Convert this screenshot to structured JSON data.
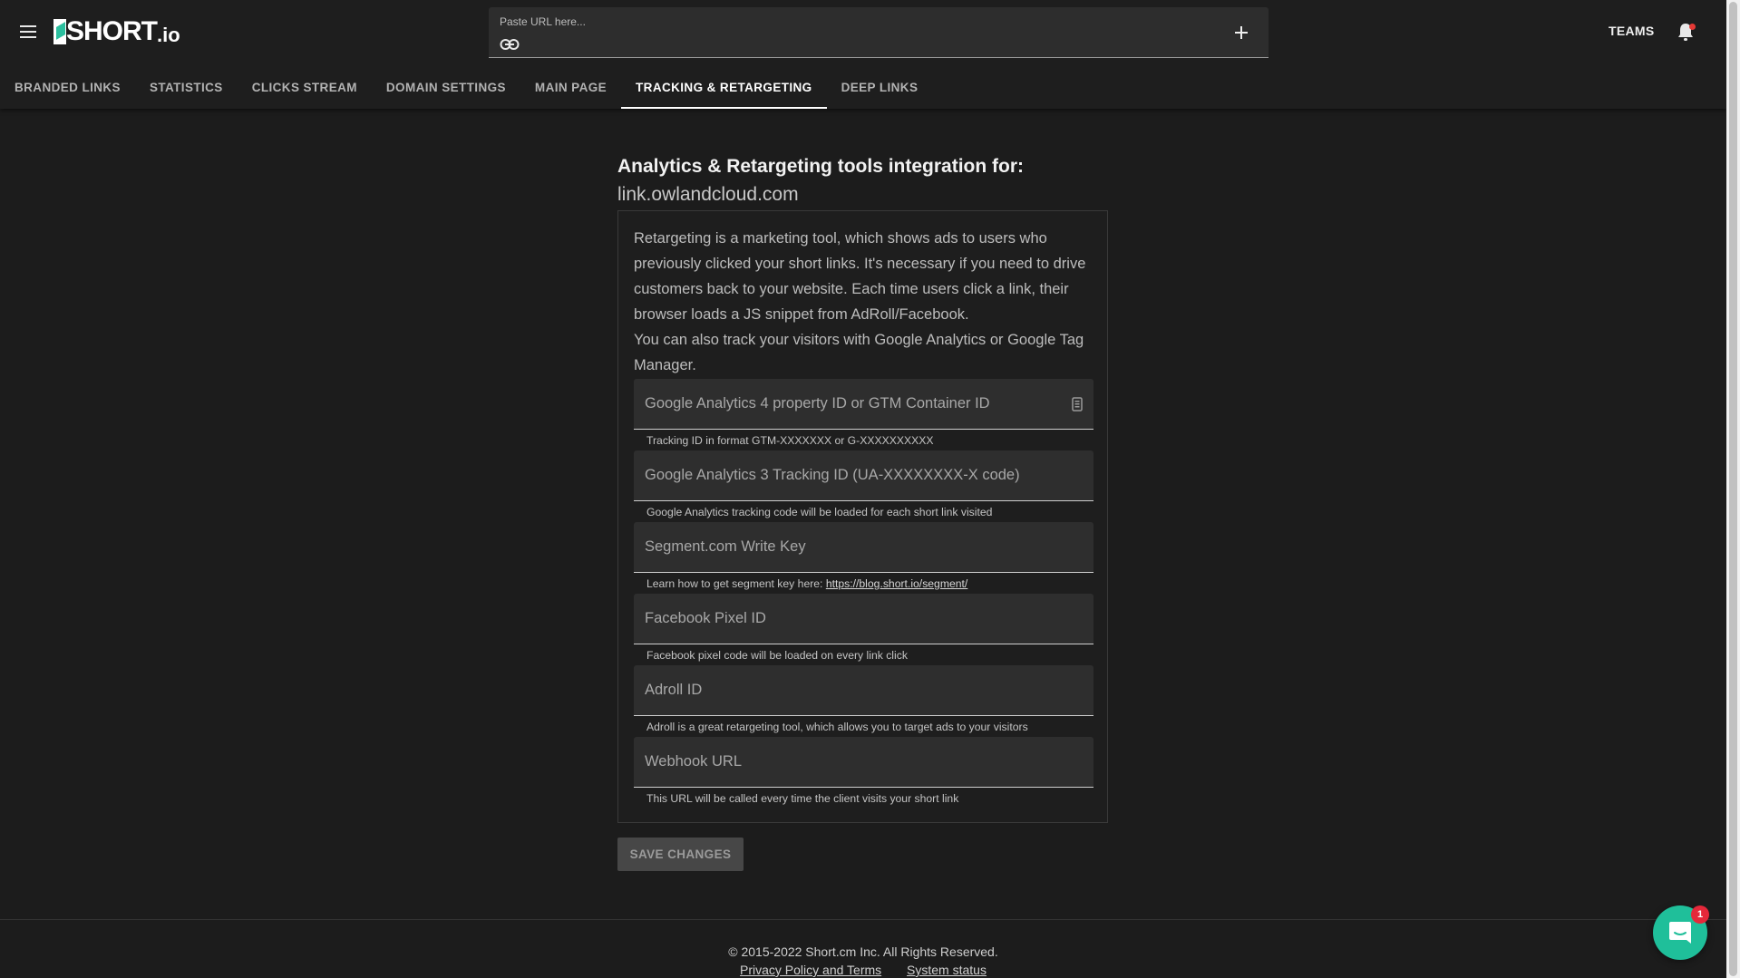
{
  "app": {
    "logo_text": "SHORT",
    "logo_tld": ".io"
  },
  "header": {
    "url_placeholder": "Paste URL here...",
    "teams_label": "TEAMS"
  },
  "tabs": [
    {
      "label": "BRANDED LINKS",
      "active": false
    },
    {
      "label": "STATISTICS",
      "active": false
    },
    {
      "label": "CLICKS STREAM",
      "active": false
    },
    {
      "label": "DOMAIN SETTINGS",
      "active": false
    },
    {
      "label": "MAIN PAGE",
      "active": false
    },
    {
      "label": "TRACKING & RETARGETING",
      "active": true
    },
    {
      "label": "DEEP LINKS",
      "active": false
    }
  ],
  "main": {
    "heading": "Analytics & Retargeting tools integration for:",
    "domain": "link.owlandcloud.com",
    "description": [
      "Retargeting is a marketing tool, which shows ads to users who previously clicked your short links. It's necessary if you need to drive customers back to your website. Each time users click a link, their browser loads a JS snippet from AdRoll/Facebook.",
      "You can also track your visitors with Google Analytics or Google Tag Manager."
    ],
    "fields": [
      {
        "placeholder": "Google Analytics 4 property ID or GTM Container ID",
        "value": "",
        "helper": "Tracking ID in format GTM-XXXXXXX or G-XXXXXXXXXX"
      },
      {
        "placeholder": "Google Analytics 3 Tracking ID (UA-XXXXXXXX-X code)",
        "value": "",
        "helper": "Google Analytics tracking code will be loaded for each short link visited"
      },
      {
        "placeholder": "Segment.com Write Key",
        "value": "",
        "helper": "Learn how to get segment key here: ",
        "helper_link": "https://blog.short.io/segment/"
      },
      {
        "placeholder": "Facebook Pixel ID",
        "value": "",
        "helper": "Facebook pixel code will be loaded on every link click"
      },
      {
        "placeholder": "Adroll ID",
        "value": "",
        "helper": "Adroll is a great retargeting tool, which allows you to target ads to your visitors"
      },
      {
        "placeholder": "Webhook URL",
        "value": "",
        "helper": "This URL will be called every time the client visits your short link"
      }
    ],
    "save_label": "SAVE CHANGES"
  },
  "footer": {
    "copyright": "© 2015-2022  Short.cm Inc. All Rights Reserved.",
    "privacy_label": "Privacy Policy and Terms",
    "status_label": "System status"
  },
  "chat": {
    "badge_count": "1"
  },
  "colors": {
    "background": "#1c1c1c",
    "accent": "#1fbf9a",
    "badge": "#e5283a"
  }
}
